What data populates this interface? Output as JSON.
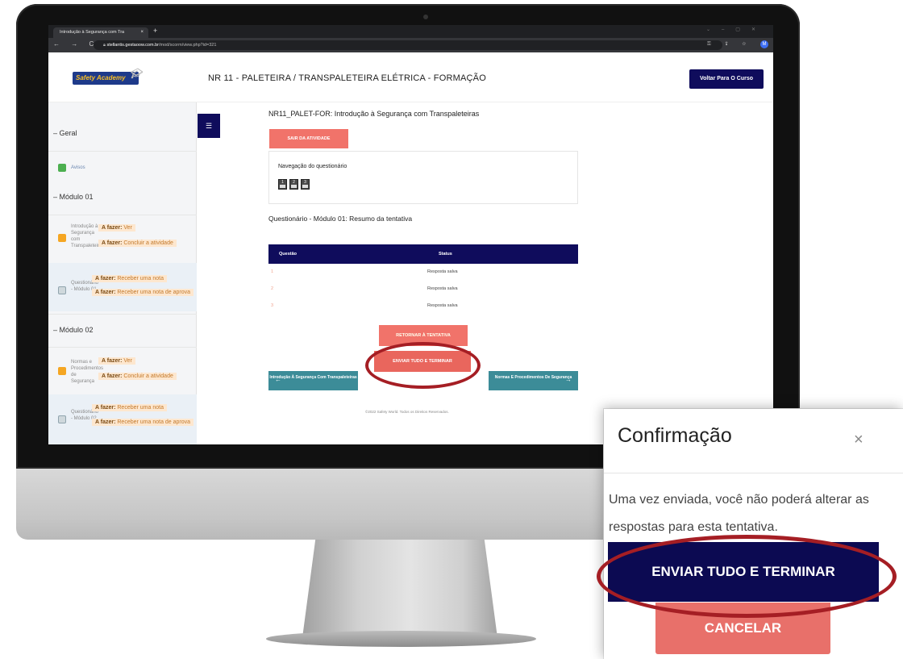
{
  "browser": {
    "tab_title": "Introdução à Segurança com Tra",
    "tab_close": "×",
    "new_tab": "+",
    "url_host": "stellantis.gestaoow.com.br",
    "url_path": "/mod/scorm/view.php?id=321",
    "nav_glyphs": "← → C",
    "profile_initial": "M"
  },
  "header": {
    "logo_text": "Safety Academy",
    "course_title": "NR 11 - PALETEIRA / TRANSPALETEIRA ELÉTRICA - FORMAÇÃO",
    "back_button": "Voltar Para O Curso"
  },
  "sidebar": {
    "section_geral": "– Geral",
    "avisos": "Avisos",
    "section_modulo1": "– Módulo 01",
    "item1_name": "Introdução à Segurança com Transpaleteiras",
    "item1_todo_view": [
      "A fazer:",
      "Ver"
    ],
    "item1_todo_complete": [
      "A fazer:",
      "Concluir a atividade"
    ],
    "item2_name": "Questionário - Módulo 01",
    "item2_todo_grade": [
      "A fazer:",
      "Receber uma nota"
    ],
    "item2_todo_pass": [
      "A fazer:",
      "Receber uma nota de aprova"
    ],
    "section_modulo2": "– Módulo 02",
    "item3_name": "Normas e Procedimentos de Segurança",
    "item3_todo_view": [
      "A fazer:",
      "Ver"
    ],
    "item3_todo_complete": [
      "A fazer:",
      "Concluir a atividade"
    ],
    "item4_name": "Questionário - Módulo 02",
    "item4_todo_grade": [
      "A fazer:",
      "Receber uma nota"
    ],
    "item4_todo_pass": [
      "A fazer:",
      "Receber uma nota de aprova"
    ]
  },
  "main": {
    "activity_title": "NR11_PALET-FOR: Introdução à Segurança com Transpaleteiras",
    "exit_button": "SAIR DA ATIVIDADE",
    "quiz_nav_label": "Navegação do questionário",
    "quiz_nav_buttons": [
      "1",
      "2",
      "3"
    ],
    "summary_title": "Questionário - Módulo 01: Resumo da tentativa",
    "table_headers": [
      "Questão",
      "Status"
    ],
    "table_rows": [
      {
        "q": "1",
        "status": "Resposta salva"
      },
      {
        "q": "2",
        "status": "Resposta salva"
      },
      {
        "q": "3",
        "status": "Resposta salva"
      }
    ],
    "retry_button": "RETORNAR À TENTATIVA",
    "finish_button": "ENVIAR TUDO E TERMINAR",
    "prev_button": "Introdução À Segurança Com Transpaleteiras",
    "next_button": "Normas E Procedimentos De Segurança",
    "footer": "©2022 Safety World. Todos os Direitos Reservados."
  },
  "modal": {
    "title": "Confirmação",
    "close": "×",
    "body": "Uma vez enviada, você não poderá alterar as respostas para esta tentativa.",
    "submit_button": "ENVIAR TUDO E TERMINAR",
    "cancel_button": "CANCELAR"
  },
  "colors": {
    "navy": "#0f0c5c",
    "coral": "#f1736a",
    "teal": "#3c8c98",
    "highlight_ring": "#a51e24"
  }
}
